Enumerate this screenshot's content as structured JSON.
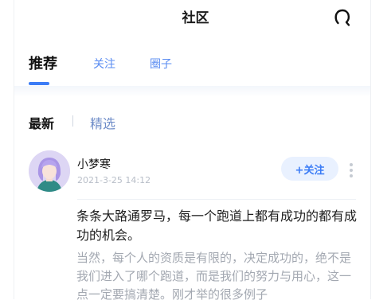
{
  "header": {
    "title": "社区",
    "search_icon": "search-icon"
  },
  "tabs": [
    {
      "label": "推荐",
      "active": true
    },
    {
      "label": "关注",
      "active": false
    },
    {
      "label": "圈子",
      "active": false
    }
  ],
  "filter": {
    "latest": "最新",
    "featured": "精选",
    "selected": "最新"
  },
  "post": {
    "author": "小梦寒",
    "time": "2021-3-25  14:12",
    "follow_label": "+关注",
    "title": "条条大路通罗马，每一个跑道上都有成功的都有成功的机会。",
    "body": "当然，每个人的资质是有限的，决定成功的，绝不是我们进入了哪个跑道，而是我们的努力与用心，这一点一定要搞清楚。刚才举的很多例子"
  },
  "colors": {
    "accent": "#3b7cf6",
    "tab_inactive": "#5a8cf2",
    "follow_bg": "#e9f1ff",
    "muted_text": "#a3a8b1"
  }
}
